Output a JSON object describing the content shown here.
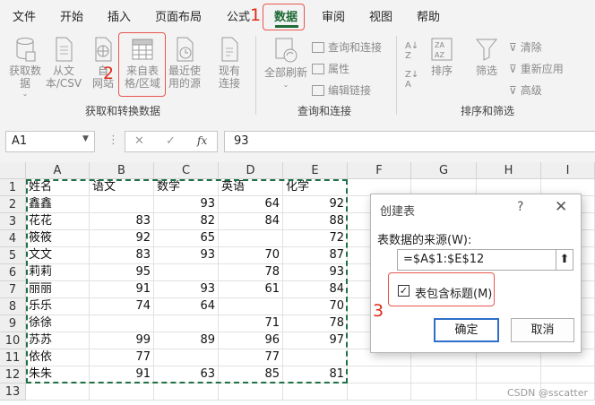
{
  "menu": {
    "items": [
      "文件",
      "开始",
      "插入",
      "页面布局",
      "公式",
      "数据",
      "审阅",
      "视图",
      "帮助"
    ],
    "active": "数据"
  },
  "annotations": {
    "step1": "1",
    "step2": "2",
    "step3": "3"
  },
  "ribbon": {
    "get_transform": {
      "get_data": "获取数\n据",
      "from_text_csv": "从文\n本/CSV",
      "from_web": "自\n网站",
      "from_table_range": "来自表\n格/区域",
      "recent_sources": "最近使\n用的源",
      "existing_connections": "现有\n连接",
      "group_label": "获取和转换数据"
    },
    "queries_connections": {
      "refresh_all": "全部刷新",
      "queries_connections": "查询和连接",
      "properties": "属性",
      "edit_links": "编辑链接",
      "group_label": "查询和连接"
    },
    "sort_filter": {
      "sort": "排序",
      "filter": "筛选",
      "clear": "清除",
      "reapply": "重新应用",
      "advanced": "高级",
      "group_label": "排序和筛选"
    }
  },
  "formula_bar": {
    "name_box": "A1",
    "cancel": "✕",
    "enter": "✓",
    "fx": "fx",
    "formula": "93"
  },
  "sheet": {
    "columns": [
      "A",
      "B",
      "C",
      "D",
      "E",
      "F",
      "G",
      "H",
      "I"
    ],
    "rows": [
      [
        "姓名",
        "语文",
        "数学",
        "英语",
        "化学"
      ],
      [
        "鑫鑫",
        "",
        "93",
        "64",
        "92"
      ],
      [
        "花花",
        "83",
        "82",
        "84",
        "88"
      ],
      [
        "筱筱",
        "92",
        "65",
        "",
        "72"
      ],
      [
        "文文",
        "83",
        "93",
        "70",
        "87"
      ],
      [
        "莉莉",
        "95",
        "",
        "78",
        "93"
      ],
      [
        "丽丽",
        "91",
        "93",
        "61",
        "84"
      ],
      [
        "乐乐",
        "74",
        "64",
        "",
        "70"
      ],
      [
        "徐徐",
        "",
        "",
        "71",
        "78"
      ],
      [
        "苏苏",
        "99",
        "89",
        "96",
        "97"
      ],
      [
        "依依",
        "77",
        "",
        "77",
        ""
      ],
      [
        "朱朱",
        "91",
        "63",
        "85",
        "81"
      ],
      [
        "",
        "",
        "",
        "",
        ""
      ]
    ]
  },
  "dialog": {
    "title": "创建表",
    "help": "?",
    "close": "✕",
    "label": "表数据的来源(W):",
    "range": "=$A$1:$E$12",
    "checkbox_checked": true,
    "checkbox_label": "表包含标题(M)",
    "ok": "确定",
    "cancel": "取消"
  },
  "watermark": "CSDN @sscatter",
  "colors": {
    "excel_green": "#1e7145",
    "callout_red": "#e8564e",
    "dialog_ok_border": "#2f6fc9"
  }
}
